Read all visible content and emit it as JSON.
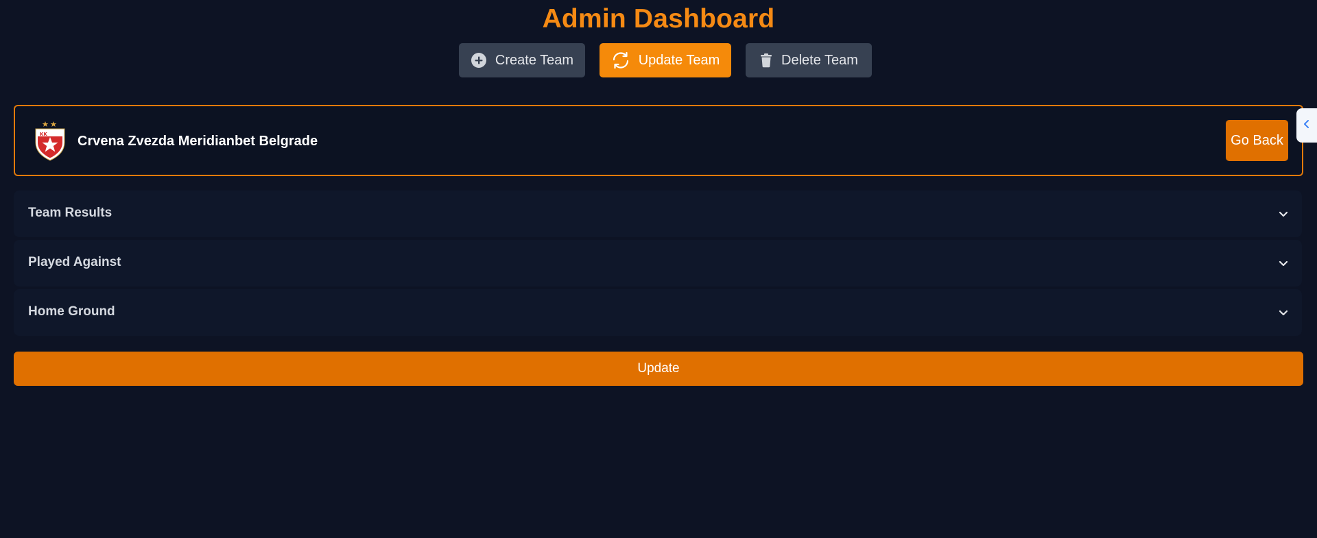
{
  "header": {
    "title": "Admin Dashboard"
  },
  "toolbar": {
    "create_label": "Create Team",
    "update_label": "Update Team",
    "delete_label": "Delete Team",
    "active_color": "#f58a0a",
    "inactive_color": "#374152"
  },
  "team": {
    "name": "Crvena Zvezda Meridianbet Belgrade",
    "crest_text": "KK",
    "go_back_label": "Go Back"
  },
  "sections": {
    "team_results": "Team Results",
    "played_against": "Played Against",
    "home_ground": "Home Ground"
  },
  "actions": {
    "update_label": "Update"
  },
  "colors": {
    "accent": "#f58a14",
    "background": "#0d1324",
    "button": "#e07000"
  }
}
